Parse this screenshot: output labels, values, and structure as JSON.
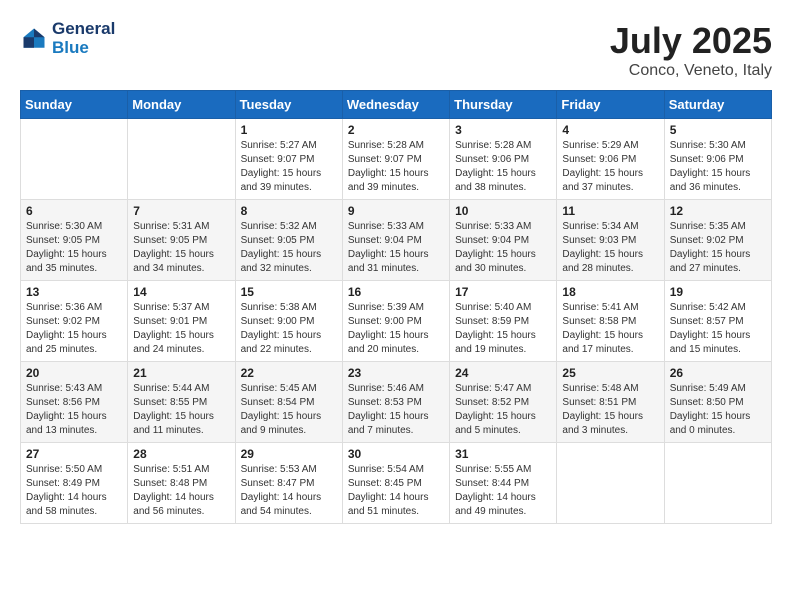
{
  "header": {
    "logo_line1": "General",
    "logo_line2": "Blue",
    "month": "July 2025",
    "location": "Conco, Veneto, Italy"
  },
  "weekdays": [
    "Sunday",
    "Monday",
    "Tuesday",
    "Wednesday",
    "Thursday",
    "Friday",
    "Saturday"
  ],
  "weeks": [
    [
      {
        "day": "",
        "info": ""
      },
      {
        "day": "",
        "info": ""
      },
      {
        "day": "1",
        "info": "Sunrise: 5:27 AM\nSunset: 9:07 PM\nDaylight: 15 hours and 39 minutes."
      },
      {
        "day": "2",
        "info": "Sunrise: 5:28 AM\nSunset: 9:07 PM\nDaylight: 15 hours and 39 minutes."
      },
      {
        "day": "3",
        "info": "Sunrise: 5:28 AM\nSunset: 9:06 PM\nDaylight: 15 hours and 38 minutes."
      },
      {
        "day": "4",
        "info": "Sunrise: 5:29 AM\nSunset: 9:06 PM\nDaylight: 15 hours and 37 minutes."
      },
      {
        "day": "5",
        "info": "Sunrise: 5:30 AM\nSunset: 9:06 PM\nDaylight: 15 hours and 36 minutes."
      }
    ],
    [
      {
        "day": "6",
        "info": "Sunrise: 5:30 AM\nSunset: 9:05 PM\nDaylight: 15 hours and 35 minutes."
      },
      {
        "day": "7",
        "info": "Sunrise: 5:31 AM\nSunset: 9:05 PM\nDaylight: 15 hours and 34 minutes."
      },
      {
        "day": "8",
        "info": "Sunrise: 5:32 AM\nSunset: 9:05 PM\nDaylight: 15 hours and 32 minutes."
      },
      {
        "day": "9",
        "info": "Sunrise: 5:33 AM\nSunset: 9:04 PM\nDaylight: 15 hours and 31 minutes."
      },
      {
        "day": "10",
        "info": "Sunrise: 5:33 AM\nSunset: 9:04 PM\nDaylight: 15 hours and 30 minutes."
      },
      {
        "day": "11",
        "info": "Sunrise: 5:34 AM\nSunset: 9:03 PM\nDaylight: 15 hours and 28 minutes."
      },
      {
        "day": "12",
        "info": "Sunrise: 5:35 AM\nSunset: 9:02 PM\nDaylight: 15 hours and 27 minutes."
      }
    ],
    [
      {
        "day": "13",
        "info": "Sunrise: 5:36 AM\nSunset: 9:02 PM\nDaylight: 15 hours and 25 minutes."
      },
      {
        "day": "14",
        "info": "Sunrise: 5:37 AM\nSunset: 9:01 PM\nDaylight: 15 hours and 24 minutes."
      },
      {
        "day": "15",
        "info": "Sunrise: 5:38 AM\nSunset: 9:00 PM\nDaylight: 15 hours and 22 minutes."
      },
      {
        "day": "16",
        "info": "Sunrise: 5:39 AM\nSunset: 9:00 PM\nDaylight: 15 hours and 20 minutes."
      },
      {
        "day": "17",
        "info": "Sunrise: 5:40 AM\nSunset: 8:59 PM\nDaylight: 15 hours and 19 minutes."
      },
      {
        "day": "18",
        "info": "Sunrise: 5:41 AM\nSunset: 8:58 PM\nDaylight: 15 hours and 17 minutes."
      },
      {
        "day": "19",
        "info": "Sunrise: 5:42 AM\nSunset: 8:57 PM\nDaylight: 15 hours and 15 minutes."
      }
    ],
    [
      {
        "day": "20",
        "info": "Sunrise: 5:43 AM\nSunset: 8:56 PM\nDaylight: 15 hours and 13 minutes."
      },
      {
        "day": "21",
        "info": "Sunrise: 5:44 AM\nSunset: 8:55 PM\nDaylight: 15 hours and 11 minutes."
      },
      {
        "day": "22",
        "info": "Sunrise: 5:45 AM\nSunset: 8:54 PM\nDaylight: 15 hours and 9 minutes."
      },
      {
        "day": "23",
        "info": "Sunrise: 5:46 AM\nSunset: 8:53 PM\nDaylight: 15 hours and 7 minutes."
      },
      {
        "day": "24",
        "info": "Sunrise: 5:47 AM\nSunset: 8:52 PM\nDaylight: 15 hours and 5 minutes."
      },
      {
        "day": "25",
        "info": "Sunrise: 5:48 AM\nSunset: 8:51 PM\nDaylight: 15 hours and 3 minutes."
      },
      {
        "day": "26",
        "info": "Sunrise: 5:49 AM\nSunset: 8:50 PM\nDaylight: 15 hours and 0 minutes."
      }
    ],
    [
      {
        "day": "27",
        "info": "Sunrise: 5:50 AM\nSunset: 8:49 PM\nDaylight: 14 hours and 58 minutes."
      },
      {
        "day": "28",
        "info": "Sunrise: 5:51 AM\nSunset: 8:48 PM\nDaylight: 14 hours and 56 minutes."
      },
      {
        "day": "29",
        "info": "Sunrise: 5:53 AM\nSunset: 8:47 PM\nDaylight: 14 hours and 54 minutes."
      },
      {
        "day": "30",
        "info": "Sunrise: 5:54 AM\nSunset: 8:45 PM\nDaylight: 14 hours and 51 minutes."
      },
      {
        "day": "31",
        "info": "Sunrise: 5:55 AM\nSunset: 8:44 PM\nDaylight: 14 hours and 49 minutes."
      },
      {
        "day": "",
        "info": ""
      },
      {
        "day": "",
        "info": ""
      }
    ]
  ]
}
